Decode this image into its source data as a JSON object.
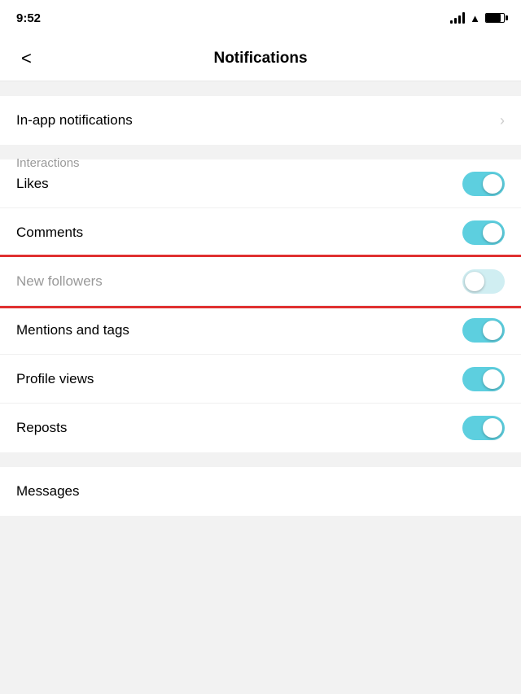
{
  "statusBar": {
    "time": "9:52",
    "signal": true,
    "wifi": true,
    "battery": true
  },
  "header": {
    "backLabel": "‹",
    "title": "Notifications"
  },
  "inAppSection": {
    "label": "In-app notifications"
  },
  "interactionsSection": {
    "sectionTitle": "Interactions",
    "items": [
      {
        "id": "likes",
        "label": "Likes",
        "state": "on",
        "muted": false
      },
      {
        "id": "comments",
        "label": "Comments",
        "state": "on",
        "muted": false
      },
      {
        "id": "new-followers",
        "label": "New followers",
        "state": "off-dim",
        "muted": true
      },
      {
        "id": "mentions-and-tags",
        "label": "Mentions and tags",
        "state": "on",
        "muted": false
      },
      {
        "id": "profile-views",
        "label": "Profile views",
        "state": "on",
        "muted": false
      },
      {
        "id": "reposts",
        "label": "Reposts",
        "state": "on",
        "muted": false
      }
    ]
  },
  "messagesSection": {
    "partialLabel": "Messages"
  }
}
